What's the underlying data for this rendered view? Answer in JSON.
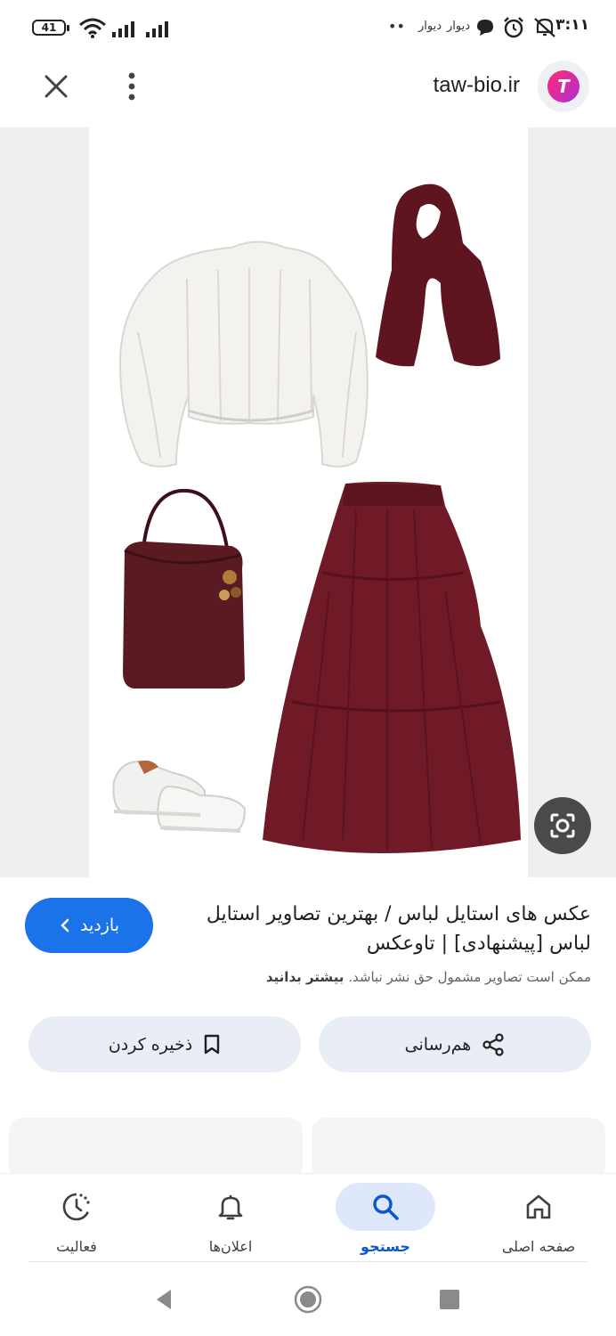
{
  "status_bar": {
    "time": "۳:۱۱",
    "battery": "41",
    "notification_1": "دیوار",
    "notification_2": "دیوار",
    "dots": "••"
  },
  "site": {
    "title": "taw-bio.ir",
    "logo_letter": "T"
  },
  "result": {
    "title": "عکس های استایل لباس / بهترین تصاویر استایل لباس [پیشنهادی] | تاوعکس",
    "copyright_note": "ممکن است تصاویر مشمول حق نشر نباشد.",
    "learn_more": "بیشتر بدانید",
    "visit_label": "بازدید"
  },
  "actions": {
    "share_label": "هم‌رسانی",
    "save_label": "ذخیره کردن"
  },
  "bottom_nav": {
    "home": "صفحه اصلی",
    "search": "جستجو",
    "notifications": "اعلان‌ها",
    "activity": "فعالیت",
    "active": "search"
  },
  "colors": {
    "accent": "#1a73e8",
    "burgundy": "#6f1a26",
    "nav_active_bg": "#dfe8fb",
    "action_bg": "#e9eef6"
  }
}
